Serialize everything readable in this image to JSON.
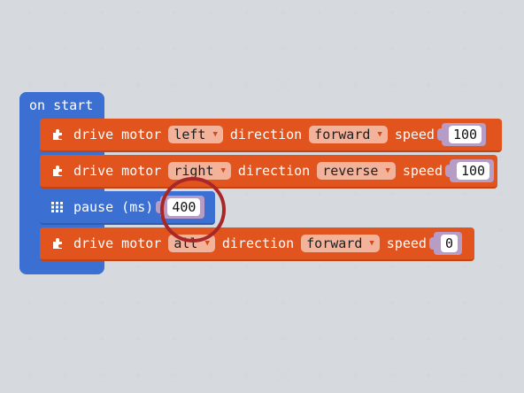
{
  "hat": {
    "label": "on start"
  },
  "blocks": [
    {
      "kind": "drive-motor",
      "text_drive": "drive motor",
      "motor": "left",
      "text_direction": "direction",
      "direction": "forward",
      "text_speed": "speed",
      "speed": "100"
    },
    {
      "kind": "drive-motor",
      "text_drive": "drive motor",
      "motor": "right",
      "text_direction": "direction",
      "direction": "reverse",
      "text_speed": "speed",
      "speed": "100"
    },
    {
      "kind": "pause",
      "text_pause": "pause (ms)",
      "ms": "400"
    },
    {
      "kind": "drive-motor",
      "text_drive": "drive motor",
      "motor": "all",
      "text_direction": "direction",
      "direction": "forward",
      "text_speed": "speed",
      "speed": "0"
    }
  ],
  "icons": {
    "motor": "puzzle-icon",
    "pause": "grid-icon",
    "caret": "caret-down-icon"
  },
  "colors": {
    "background": "#eceef0",
    "motor_block": "#e2541e",
    "basic_block": "#3b6fd1",
    "dropdown": "#f3b39b",
    "value_slot": "#b79cc6",
    "highlight": "#a8282a"
  }
}
